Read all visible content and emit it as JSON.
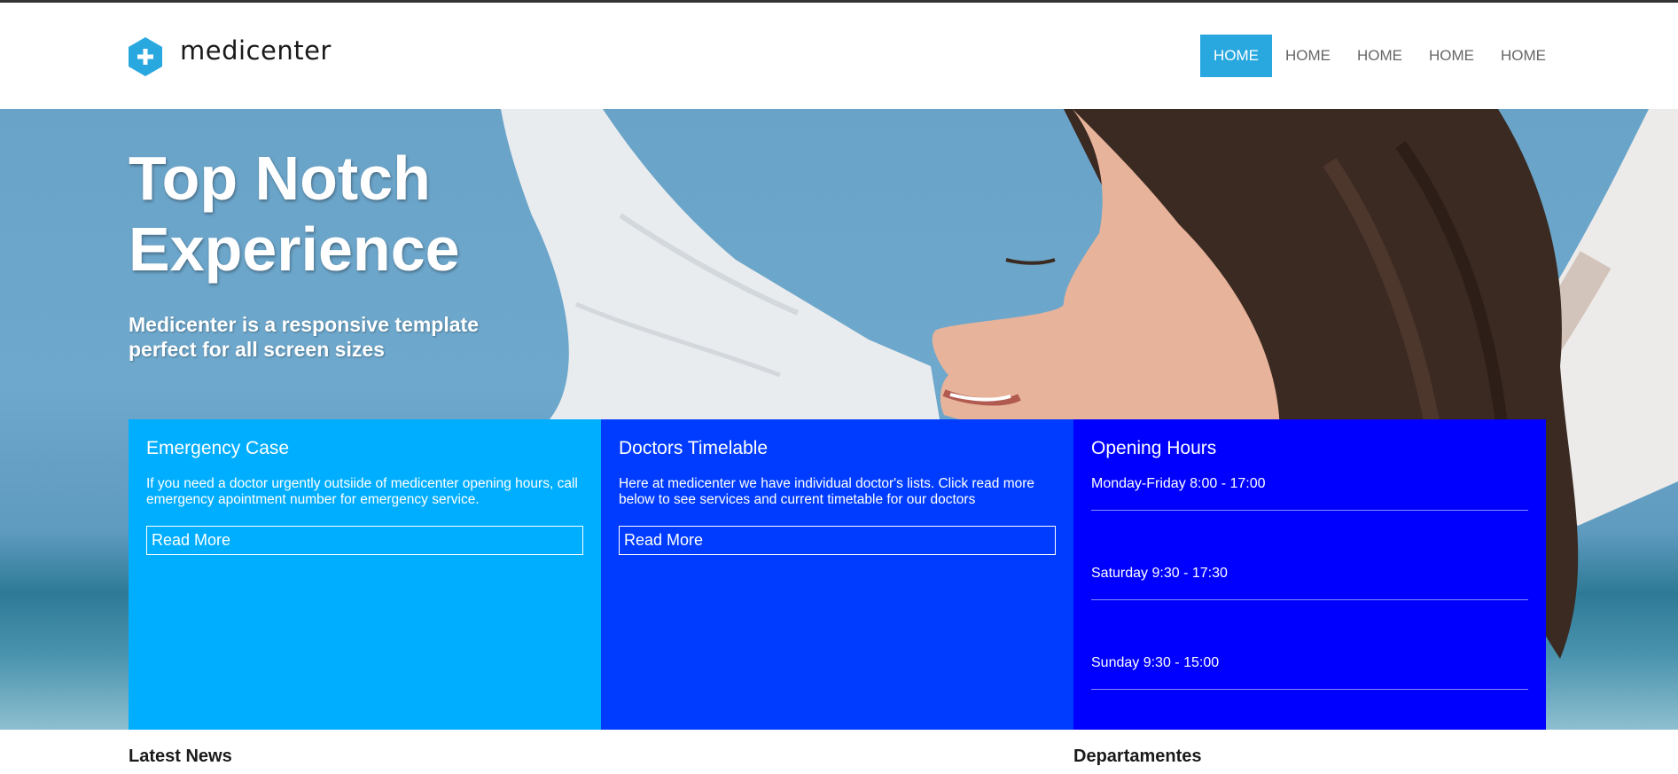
{
  "brand": {
    "name": "medicenter",
    "accent": "#29a8e0"
  },
  "nav": {
    "items": [
      {
        "label": "HOME",
        "active": true
      },
      {
        "label": "HOME",
        "active": false
      },
      {
        "label": "HOME",
        "active": false
      },
      {
        "label": "HOME",
        "active": false
      },
      {
        "label": "HOME",
        "active": false
      }
    ]
  },
  "hero": {
    "title_line1": "Top Notch",
    "title_line2": "Experience",
    "subtitle": "Medicenter is a responsive template perfect for all screen sizes"
  },
  "boxes": [
    {
      "title": "Emergency Case",
      "text": "If you need a doctor urgently outsiide of medicenter opening hours, call emergency apointment number for emergency service.",
      "button": "Read More",
      "color": "#00aeff"
    },
    {
      "title": "Doctors Timelable",
      "text": "Here at medicenter we have individual doctor's lists. Click read more below to see services and current timetable for our doctors",
      "button": "Read More",
      "color": "#003cff"
    },
    {
      "title": "Opening Hours",
      "hours": [
        "Monday-Friday 8:00 - 17:00",
        "Saturday 9:30 - 17:30",
        "Sunday 9:30 - 15:00"
      ],
      "color": "#0000ff"
    }
  ],
  "sections": {
    "latest_news": "Latest News",
    "departments": "Departamentes"
  }
}
